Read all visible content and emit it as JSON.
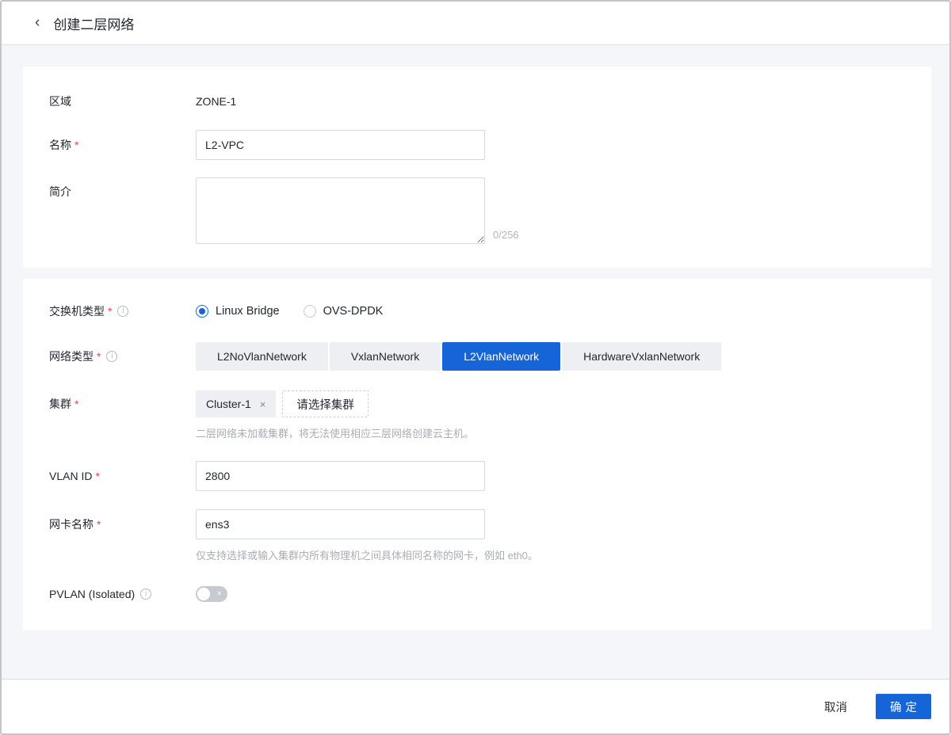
{
  "accent_color": "#1565d8",
  "marks": {
    "required": "*"
  },
  "icons": {
    "back": "‹",
    "info": "i",
    "close": "×",
    "toggle_off": "×"
  },
  "header": {
    "title": "创建二层网络"
  },
  "form": {
    "zone": {
      "label": "区域",
      "value": "ZONE-1"
    },
    "name": {
      "label": "名称",
      "required": true,
      "value": "L2-VPC"
    },
    "description": {
      "label": "简介",
      "value": "",
      "counter": "0/256"
    },
    "switch_type": {
      "label": "交换机类型",
      "required": true,
      "options": [
        {
          "label": "Linux Bridge",
          "selected": true
        },
        {
          "label": "OVS-DPDK",
          "selected": false
        }
      ]
    },
    "network_type": {
      "label": "网络类型",
      "required": true,
      "options": [
        {
          "label": "L2NoVlanNetwork",
          "selected": false
        },
        {
          "label": "VxlanNetwork",
          "selected": false
        },
        {
          "label": "L2VlanNetwork",
          "selected": true
        },
        {
          "label": "HardwareVxlanNetwork",
          "selected": false
        }
      ],
      "selected": "L2VlanNetwork"
    },
    "cluster": {
      "label": "集群",
      "required": true,
      "selected_tag": "Cluster-1",
      "add_button": "请选择集群",
      "helper": "二层网络未加载集群，将无法使用相应三层网络创建云主机。"
    },
    "vlan_id": {
      "label": "VLAN ID",
      "required": true,
      "value": "2800"
    },
    "nic_name": {
      "label": "网卡名称",
      "required": true,
      "value": "ens3",
      "helper": "仅支持选择或输入集群内所有物理机之间具体相同名称的网卡，例如 eth0。"
    },
    "pvlan": {
      "label": "PVLAN (Isolated)",
      "toggle_state": "off"
    }
  },
  "footer": {
    "cancel_label": "取消",
    "confirm_label": "确定"
  }
}
